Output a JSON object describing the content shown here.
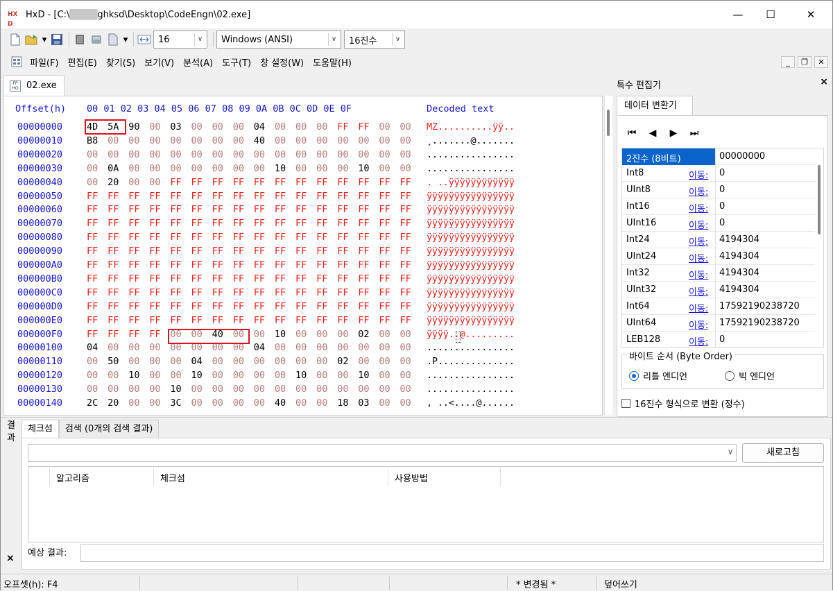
{
  "window": {
    "title_prefix": "HxD - [C:\\",
    "title_redacted": "████",
    "title_suffix": "ghksd\\Desktop\\CodeEngn\\02.exe]",
    "app_icon_text": "HX D",
    "min_icon": "—",
    "max_icon": "☐",
    "close_icon": "✕"
  },
  "toolbar": {
    "bytes_per_row": "16",
    "charset": "Windows (ANSI)",
    "offset_base": "16진수"
  },
  "menu": [
    "파일(F)",
    "편집(E)",
    "찾기(S)",
    "보기(V)",
    "분석(A)",
    "도구(T)",
    "창 설정(W)",
    "도움말(H)"
  ],
  "doc_tab": {
    "label": "02.exe",
    "icon_text": "FP HO"
  },
  "hex_view": {
    "header_offset": "Offset(h)",
    "header_cols": "00 01 02 03 04 05 06 07 08 09 0A 0B 0C 0D 0E 0F",
    "header_decoded": "Decoded text",
    "rows": [
      {
        "offset": "00000000",
        "bytes": [
          "4D",
          "5A",
          "90",
          "00",
          "03",
          "00",
          "00",
          "00",
          "04",
          "00",
          "00",
          "00",
          "FF",
          "FF",
          "00",
          "00"
        ],
        "text": "MZ..........ÿÿ.."
      },
      {
        "offset": "00000010",
        "bytes": [
          "B8",
          "00",
          "00",
          "00",
          "00",
          "00",
          "00",
          "00",
          "40",
          "00",
          "00",
          "00",
          "00",
          "00",
          "00",
          "00"
        ],
        "text": "¸.......@......."
      },
      {
        "offset": "00000020",
        "bytes": [
          "00",
          "00",
          "00",
          "00",
          "00",
          "00",
          "00",
          "00",
          "00",
          "00",
          "00",
          "00",
          "00",
          "00",
          "00",
          "00"
        ],
        "text": "................"
      },
      {
        "offset": "00000030",
        "bytes": [
          "00",
          "0A",
          "00",
          "00",
          "00",
          "00",
          "00",
          "00",
          "00",
          "10",
          "00",
          "00",
          "00",
          "10",
          "00",
          "00"
        ],
        "text": "................"
      },
      {
        "offset": "00000040",
        "bytes": [
          "00",
          "20",
          "00",
          "00",
          "FF",
          "FF",
          "FF",
          "FF",
          "FF",
          "FF",
          "FF",
          "FF",
          "FF",
          "FF",
          "FF",
          "FF"
        ],
        "text": ". ..ÿÿÿÿÿÿÿÿÿÿÿÿ"
      },
      {
        "offset": "00000050",
        "bytes": [
          "FF",
          "FF",
          "FF",
          "FF",
          "FF",
          "FF",
          "FF",
          "FF",
          "FF",
          "FF",
          "FF",
          "FF",
          "FF",
          "FF",
          "FF",
          "FF"
        ],
        "text": "ÿÿÿÿÿÿÿÿÿÿÿÿÿÿÿÿ"
      },
      {
        "offset": "00000060",
        "bytes": [
          "FF",
          "FF",
          "FF",
          "FF",
          "FF",
          "FF",
          "FF",
          "FF",
          "FF",
          "FF",
          "FF",
          "FF",
          "FF",
          "FF",
          "FF",
          "FF"
        ],
        "text": "ÿÿÿÿÿÿÿÿÿÿÿÿÿÿÿÿ"
      },
      {
        "offset": "00000070",
        "bytes": [
          "FF",
          "FF",
          "FF",
          "FF",
          "FF",
          "FF",
          "FF",
          "FF",
          "FF",
          "FF",
          "FF",
          "FF",
          "FF",
          "FF",
          "FF",
          "FF"
        ],
        "text": "ÿÿÿÿÿÿÿÿÿÿÿÿÿÿÿÿ"
      },
      {
        "offset": "00000080",
        "bytes": [
          "FF",
          "FF",
          "FF",
          "FF",
          "FF",
          "FF",
          "FF",
          "FF",
          "FF",
          "FF",
          "FF",
          "FF",
          "FF",
          "FF",
          "FF",
          "FF"
        ],
        "text": "ÿÿÿÿÿÿÿÿÿÿÿÿÿÿÿÿ"
      },
      {
        "offset": "00000090",
        "bytes": [
          "FF",
          "FF",
          "FF",
          "FF",
          "FF",
          "FF",
          "FF",
          "FF",
          "FF",
          "FF",
          "FF",
          "FF",
          "FF",
          "FF",
          "FF",
          "FF"
        ],
        "text": "ÿÿÿÿÿÿÿÿÿÿÿÿÿÿÿÿ"
      },
      {
        "offset": "000000A0",
        "bytes": [
          "FF",
          "FF",
          "FF",
          "FF",
          "FF",
          "FF",
          "FF",
          "FF",
          "FF",
          "FF",
          "FF",
          "FF",
          "FF",
          "FF",
          "FF",
          "FF"
        ],
        "text": "ÿÿÿÿÿÿÿÿÿÿÿÿÿÿÿÿ"
      },
      {
        "offset": "000000B0",
        "bytes": [
          "FF",
          "FF",
          "FF",
          "FF",
          "FF",
          "FF",
          "FF",
          "FF",
          "FF",
          "FF",
          "FF",
          "FF",
          "FF",
          "FF",
          "FF",
          "FF"
        ],
        "text": "ÿÿÿÿÿÿÿÿÿÿÿÿÿÿÿÿ"
      },
      {
        "offset": "000000C0",
        "bytes": [
          "FF",
          "FF",
          "FF",
          "FF",
          "FF",
          "FF",
          "FF",
          "FF",
          "FF",
          "FF",
          "FF",
          "FF",
          "FF",
          "FF",
          "FF",
          "FF"
        ],
        "text": "ÿÿÿÿÿÿÿÿÿÿÿÿÿÿÿÿ"
      },
      {
        "offset": "000000D0",
        "bytes": [
          "FF",
          "FF",
          "FF",
          "FF",
          "FF",
          "FF",
          "FF",
          "FF",
          "FF",
          "FF",
          "FF",
          "FF",
          "FF",
          "FF",
          "FF",
          "FF"
        ],
        "text": "ÿÿÿÿÿÿÿÿÿÿÿÿÿÿÿÿ"
      },
      {
        "offset": "000000E0",
        "bytes": [
          "FF",
          "FF",
          "FF",
          "FF",
          "FF",
          "FF",
          "FF",
          "FF",
          "FF",
          "FF",
          "FF",
          "FF",
          "FF",
          "FF",
          "FF",
          "FF"
        ],
        "text": "ÿÿÿÿÿÿÿÿÿÿÿÿÿÿÿÿ"
      },
      {
        "offset": "000000F0",
        "bytes": [
          "FF",
          "FF",
          "FF",
          "FF",
          "00",
          "00",
          "40",
          "00",
          "00",
          "10",
          "00",
          "00",
          "00",
          "02",
          "00",
          "00"
        ],
        "text": "ÿÿÿÿ..@........."
      },
      {
        "offset": "00000100",
        "bytes": [
          "04",
          "00",
          "00",
          "00",
          "00",
          "00",
          "00",
          "00",
          "04",
          "00",
          "00",
          "00",
          "00",
          "00",
          "00",
          "00"
        ],
        "text": "................"
      },
      {
        "offset": "00000110",
        "bytes": [
          "00",
          "50",
          "00",
          "00",
          "00",
          "04",
          "00",
          "00",
          "00",
          "00",
          "00",
          "00",
          "02",
          "00",
          "00",
          "00"
        ],
        "text": ".P.............."
      },
      {
        "offset": "00000120",
        "bytes": [
          "00",
          "00",
          "10",
          "00",
          "00",
          "10",
          "00",
          "00",
          "00",
          "00",
          "10",
          "00",
          "00",
          "10",
          "00",
          "00"
        ],
        "text": "................"
      },
      {
        "offset": "00000130",
        "bytes": [
          "00",
          "00",
          "00",
          "00",
          "10",
          "00",
          "00",
          "00",
          "00",
          "00",
          "00",
          "00",
          "00",
          "00",
          "00",
          "00"
        ],
        "text": "................"
      },
      {
        "offset": "00000140",
        "bytes": [
          "2C",
          "20",
          "00",
          "00",
          "3C",
          "00",
          "00",
          "00",
          "00",
          "40",
          "00",
          "00",
          "18",
          "03",
          "00",
          "00"
        ],
        "text": ", ..<....@......"
      }
    ]
  },
  "inspector": {
    "title": "특수 편집기",
    "close": "×",
    "tab": "데이터 변환기",
    "nav": [
      "⏮",
      "◀",
      "▶",
      "⏭"
    ],
    "rows": [
      {
        "name": "2진수 (8비트)",
        "link": "",
        "value": "00000000"
      },
      {
        "name": "Int8",
        "link": "이동:",
        "value": "0"
      },
      {
        "name": "UInt8",
        "link": "이동:",
        "value": "0"
      },
      {
        "name": "Int16",
        "link": "이동:",
        "value": "0"
      },
      {
        "name": "UInt16",
        "link": "이동:",
        "value": "0"
      },
      {
        "name": "Int24",
        "link": "이동:",
        "value": "4194304"
      },
      {
        "name": "UInt24",
        "link": "이동:",
        "value": "4194304"
      },
      {
        "name": "Int32",
        "link": "이동:",
        "value": "4194304"
      },
      {
        "name": "UInt32",
        "link": "이동:",
        "value": "4194304"
      },
      {
        "name": "Int64",
        "link": "이동:",
        "value": "17592190238720"
      },
      {
        "name": "UInt64",
        "link": "이동:",
        "value": "17592190238720"
      },
      {
        "name": "LEB128",
        "link": "이동:",
        "value": "0"
      }
    ],
    "byte_order_label": "바이트 순서 (Byte Order)",
    "little_endian": "리틀 엔디언",
    "big_endian": "빅 엔디언",
    "hex_checkbox": "16진수 형식으로 변환 (정수)"
  },
  "results": {
    "side_label": "결과",
    "close": "×",
    "tabs": [
      "체크섬",
      "검색 (0개의 검색 결과)"
    ],
    "refresh": "새로고침",
    "columns": [
      "알고리즘",
      "체크섬",
      "사용방법"
    ],
    "expected_label": "예상 결과:"
  },
  "status": {
    "offset": "오프셋(h): F4",
    "modified": "* 변경됨 *",
    "mode": "덮어쓰기"
  }
}
